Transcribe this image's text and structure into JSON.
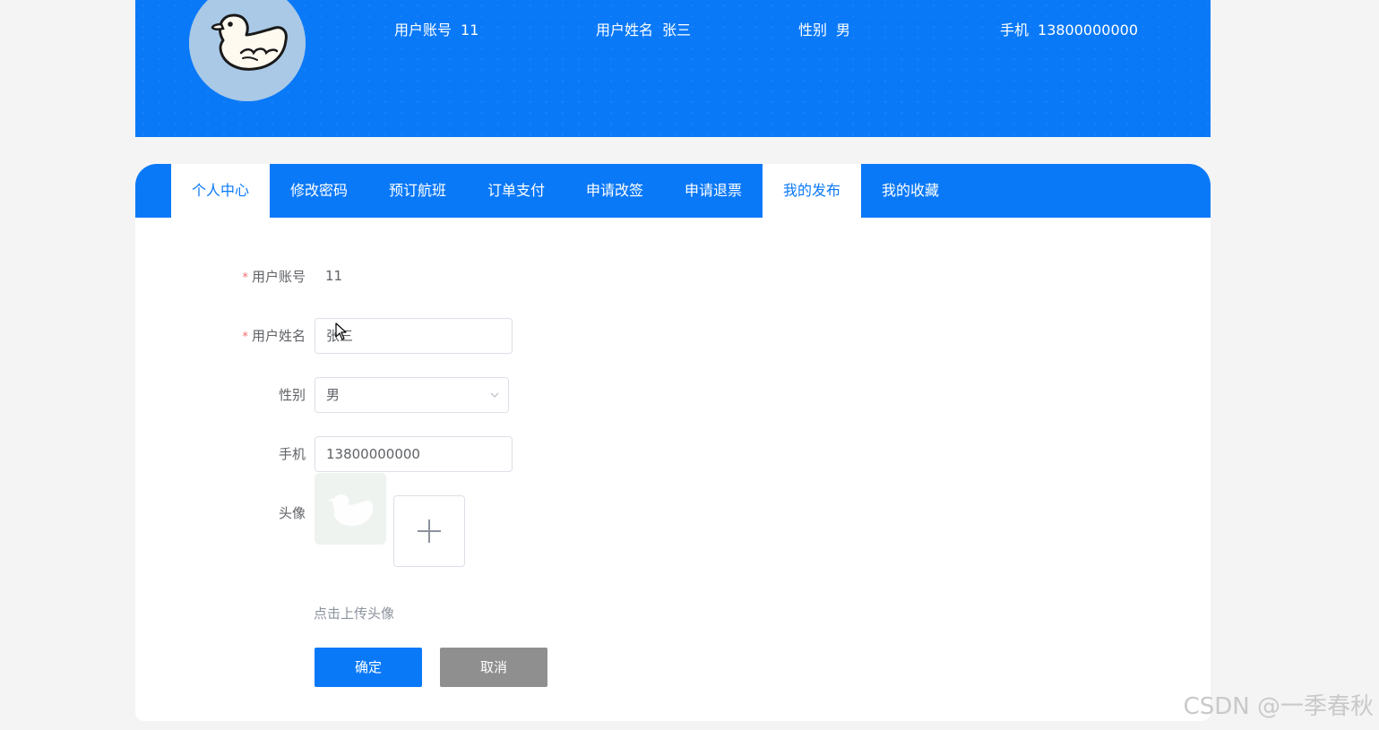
{
  "header": {
    "account_label": "用户账号",
    "account_value": "11",
    "name_label": "用户姓名",
    "name_value": "张三",
    "gender_label": "性别",
    "gender_value": "男",
    "phone_label": "手机",
    "phone_value": "13800000000",
    "avatar_icon": "duck-avatar-icon"
  },
  "tabs": [
    {
      "label": "个人中心",
      "active": true
    },
    {
      "label": "修改密码",
      "active": false
    },
    {
      "label": "预订航班",
      "active": false
    },
    {
      "label": "订单支付",
      "active": false
    },
    {
      "label": "申请改签",
      "active": false
    },
    {
      "label": "申请退票",
      "active": false
    },
    {
      "label": "我的发布",
      "active": true
    },
    {
      "label": "我的收藏",
      "active": false
    }
  ],
  "form": {
    "required_mark": "*",
    "account_label": "用户账号",
    "account_value": "11",
    "name_label": "用户姓名",
    "name_value": "张三",
    "gender_label": "性别",
    "gender_value": "男",
    "phone_label": "手机",
    "phone_value": "13800000000",
    "avatar_label": "头像",
    "upload_hint": "点击上传头像",
    "confirm_label": "确定",
    "cancel_label": "取消"
  },
  "colors": {
    "primary": "#0a79f8",
    "cancel": "#8f8f8f",
    "required": "#f56c6c"
  },
  "watermark": "CSDN @一季春秋"
}
